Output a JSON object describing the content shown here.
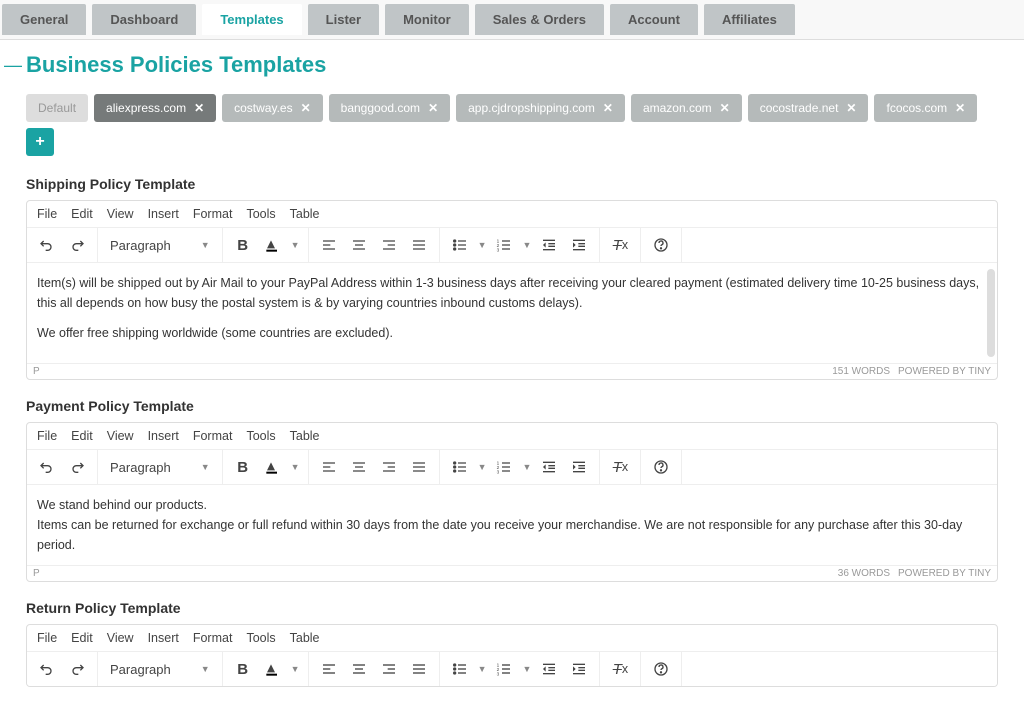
{
  "tabs": {
    "items": [
      {
        "label": "General"
      },
      {
        "label": "Dashboard"
      },
      {
        "label": "Templates",
        "active": true
      },
      {
        "label": "Lister"
      },
      {
        "label": "Monitor"
      },
      {
        "label": "Sales & Orders"
      },
      {
        "label": "Account"
      },
      {
        "label": "Affiliates"
      }
    ]
  },
  "page": {
    "title": "Business Policies Templates"
  },
  "pills": {
    "default_label": "Default",
    "items": [
      "aliexpress.com",
      "costway.es",
      "banggood.com",
      "app.cjdropshipping.com",
      "amazon.com",
      "cocostrade.net",
      "fcocos.com"
    ],
    "add": "+"
  },
  "editor": {
    "menubar": [
      "File",
      "Edit",
      "View",
      "Insert",
      "Format",
      "Tools",
      "Table"
    ],
    "block_label": "Paragraph",
    "statusbar_path": "P",
    "powered_by": "POWERED BY TINY"
  },
  "sections": [
    {
      "title": "Shipping Policy Template",
      "word_count": "151 WORDS",
      "paragraphs": [
        "Item(s) will be shipped out by Air Mail to your PayPal Address within 1-3 business days after receiving your cleared payment (estimated delivery time 10-25 business days, this all depends on how busy the postal system is & by varying countries inbound customs delays).",
        "We offer free shipping worldwide (some countries are excluded)."
      ],
      "scroll": true
    },
    {
      "title": "Payment Policy Template",
      "word_count": "36 WORDS",
      "paragraphs": [
        "We stand behind our products.",
        "Items can be returned for exchange or full refund within 30 days from the date you receive your merchandise. We are not responsible for any purchase after this 30-day period."
      ],
      "scroll": false
    },
    {
      "title": "Return Policy Template",
      "word_count": "",
      "paragraphs": [],
      "scroll": false
    }
  ],
  "colors": {
    "accent": "#1aa3a3"
  }
}
